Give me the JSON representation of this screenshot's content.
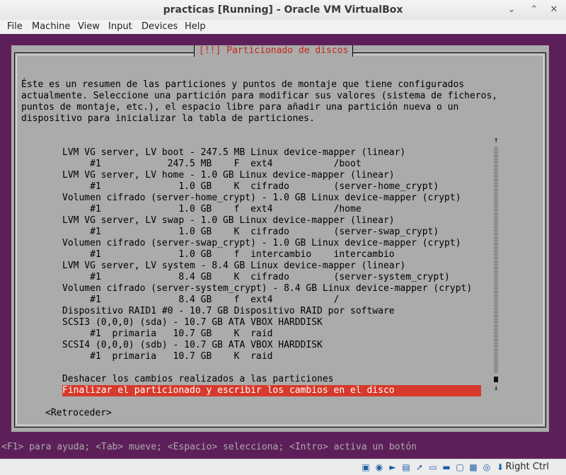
{
  "window": {
    "title": "practicas [Running] - Oracle VM VirtualBox",
    "minimize_icon": "chevron-down-icon",
    "maximize_icon": "chevron-up-icon",
    "close_icon": "close-icon"
  },
  "menu": [
    "File",
    "Machine",
    "View",
    "Input",
    "Devices",
    "Help"
  ],
  "dialog": {
    "title": "[!!] Particionado de discos",
    "intro": [
      "Éste es un resumen de las particiones y puntos de montaje que tiene configurados",
      "actualmente. Seleccione una partición para modificar sus valores (sistema de ficheros,",
      "puntos de montaje, etc.), el espacio libre para añadir una partición nueva o un",
      "dispositivo para inicializar la tabla de particiones."
    ],
    "partitions": [
      "LVM VG server, LV boot - 247.5 MB Linux device-mapper (linear)",
      "     #1            247.5 MB    F  ext4           /boot",
      "LVM VG server, LV home - 1.0 GB Linux device-mapper (linear)",
      "     #1              1.0 GB    K  cifrado        (server-home_crypt)",
      "Volumen cifrado (server-home_crypt) - 1.0 GB Linux device-mapper (crypt)",
      "     #1              1.0 GB    f  ext4           /home",
      "LVM VG server, LV swap - 1.0 GB Linux device-mapper (linear)",
      "     #1              1.0 GB    K  cifrado        (server-swap_crypt)",
      "Volumen cifrado (server-swap_crypt) - 1.0 GB Linux device-mapper (crypt)",
      "     #1              1.0 GB    f  intercambio    intercambio",
      "LVM VG server, LV system - 8.4 GB Linux device-mapper (linear)",
      "     #1              8.4 GB    K  cifrado        (server-system_crypt)",
      "Volumen cifrado (server-system_crypt) - 8.4 GB Linux device-mapper (crypt)",
      "     #1              8.4 GB    f  ext4           /",
      "Dispositivo RAID1 #0 - 10.7 GB Dispositivo RAID por software",
      "SCSI3 (0,0,0) (sda) - 10.7 GB ATA VBOX HARDDISK",
      "     #1  primaria   10.7 GB    K  raid",
      "SCSI4 (0,0,0) (sdb) - 10.7 GB ATA VBOX HARDDISK",
      "     #1  primaria   10.7 GB    K  raid"
    ],
    "undo_option": "Deshacer los cambios realizados a las particiones",
    "finish_option": "Finalizar el particionado y escribir los cambios en el disco",
    "back_button": "<Retroceder>",
    "scroll_up": "↑",
    "scroll_down": "↓"
  },
  "help_line": "<F1> para ayuda; <Tab> mueve; <Espacio> selecciona; <Intro> activa un botón",
  "statusbar": {
    "icons": [
      "hard-disk-icon",
      "optical-drive-icon",
      "audio-icon",
      "network-icon",
      "usb-icon",
      "shared-folder-icon",
      "display-icon",
      "video-capture-icon",
      "cpu-icon",
      "mouse-integration-icon",
      "arrow-icon"
    ],
    "host_key": "Right Ctrl"
  }
}
